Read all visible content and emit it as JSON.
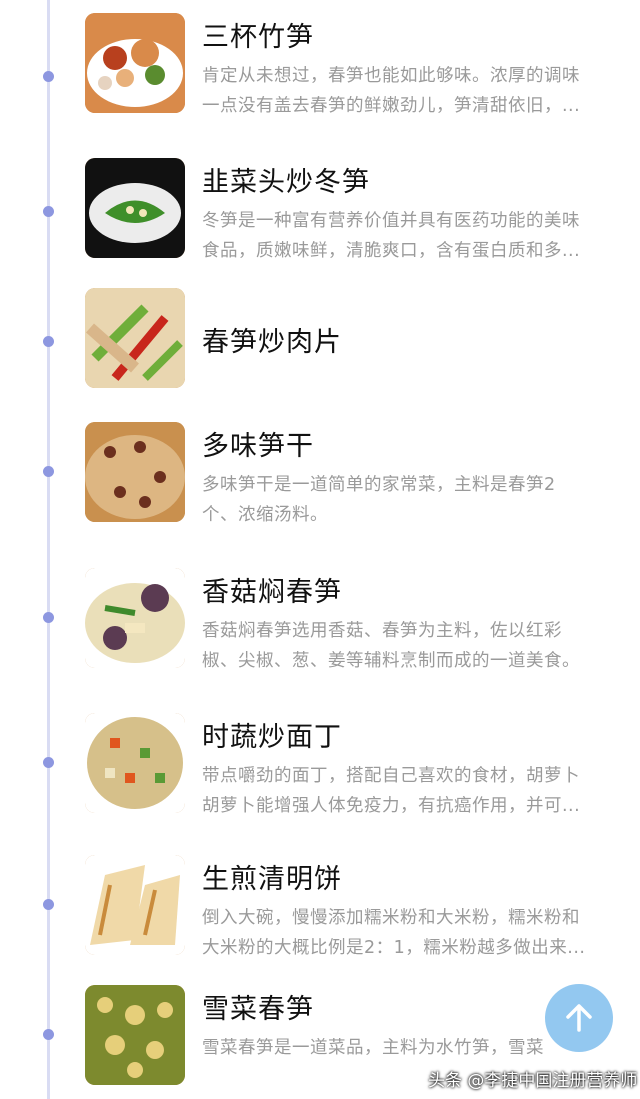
{
  "items": [
    {
      "title": "三杯竹笋",
      "desc": [
        "肯定从未想过，春笋也能如此够味。浓厚的调味",
        "一点没有盖去春笋的鲜嫩劲儿，笋清甜依旧，..."
      ],
      "thumb": {
        "bg": "#d98a4a",
        "accent": "#5a8c2f",
        "plate": "#ffffff"
      }
    },
    {
      "title": "韭菜头炒冬笋",
      "desc": [
        "冬笋是一种富有营养价值并具有医药功能的美味",
        "食品，质嫩味鲜，清脆爽口，含有蛋白质和多..."
      ],
      "thumb": {
        "bg": "#111111",
        "accent": "#3f8f2a",
        "plate": "#ececec"
      }
    },
    {
      "title": "春笋炒肉片",
      "desc": [],
      "thumb": {
        "bg": "#e9d6b0",
        "accent": "#c8261c",
        "plate": "#6fae3a"
      }
    },
    {
      "title": "多味笋干",
      "desc": [
        "多味笋干是一道简单的家常菜，主料是春笋2",
        "个、浓缩汤料。"
      ],
      "thumb": {
        "bg": "#c9904e",
        "accent": "#6b2f1e",
        "plate": "#f1dcb5"
      }
    },
    {
      "title": "香菇焖春笋",
      "desc": [
        "香菇焖春笋选用香菇、春笋为主料，佐以红彩",
        "椒、尖椒、葱、姜等辅料烹制而成的一道美食。"
      ],
      "thumb": {
        "bg": "#eadfb9",
        "accent": "#5b3b52",
        "plate": "#3f8a2c"
      }
    },
    {
      "title": "时蔬炒面丁",
      "desc": [
        "带点嚼劲的面丁，搭配自己喜欢的食材，胡萝卜",
        "胡萝卜能增强人体免疫力，有抗癌作用，并可..."
      ],
      "thumb": {
        "bg": "#d6c08a",
        "accent": "#e0561e",
        "plate": "#5a9a35"
      }
    },
    {
      "title": "生煎清明饼",
      "desc": [
        "倒入大碗，慢慢添加糯米粉和大米粉，糯米粉和",
        "大米粉的大概比例是2：1，糯米粉越多做出来..."
      ],
      "thumb": {
        "bg": "#f0d9a8",
        "accent": "#c98b3c",
        "plate": "#ffffff"
      }
    },
    {
      "title": "雪菜春笋",
      "desc": [
        "雪菜春笋是一道菜品，主料为水竹笋，雪菜"
      ],
      "thumb": {
        "bg": "#7d8a2e",
        "accent": "#e6cf7a",
        "plate": "#4d5a1c"
      }
    }
  ],
  "scroll_top": {
    "icon": "arrow-up-icon",
    "color": "#93c8f0"
  },
  "watermark": "头条 @李捷中国注册营养师"
}
